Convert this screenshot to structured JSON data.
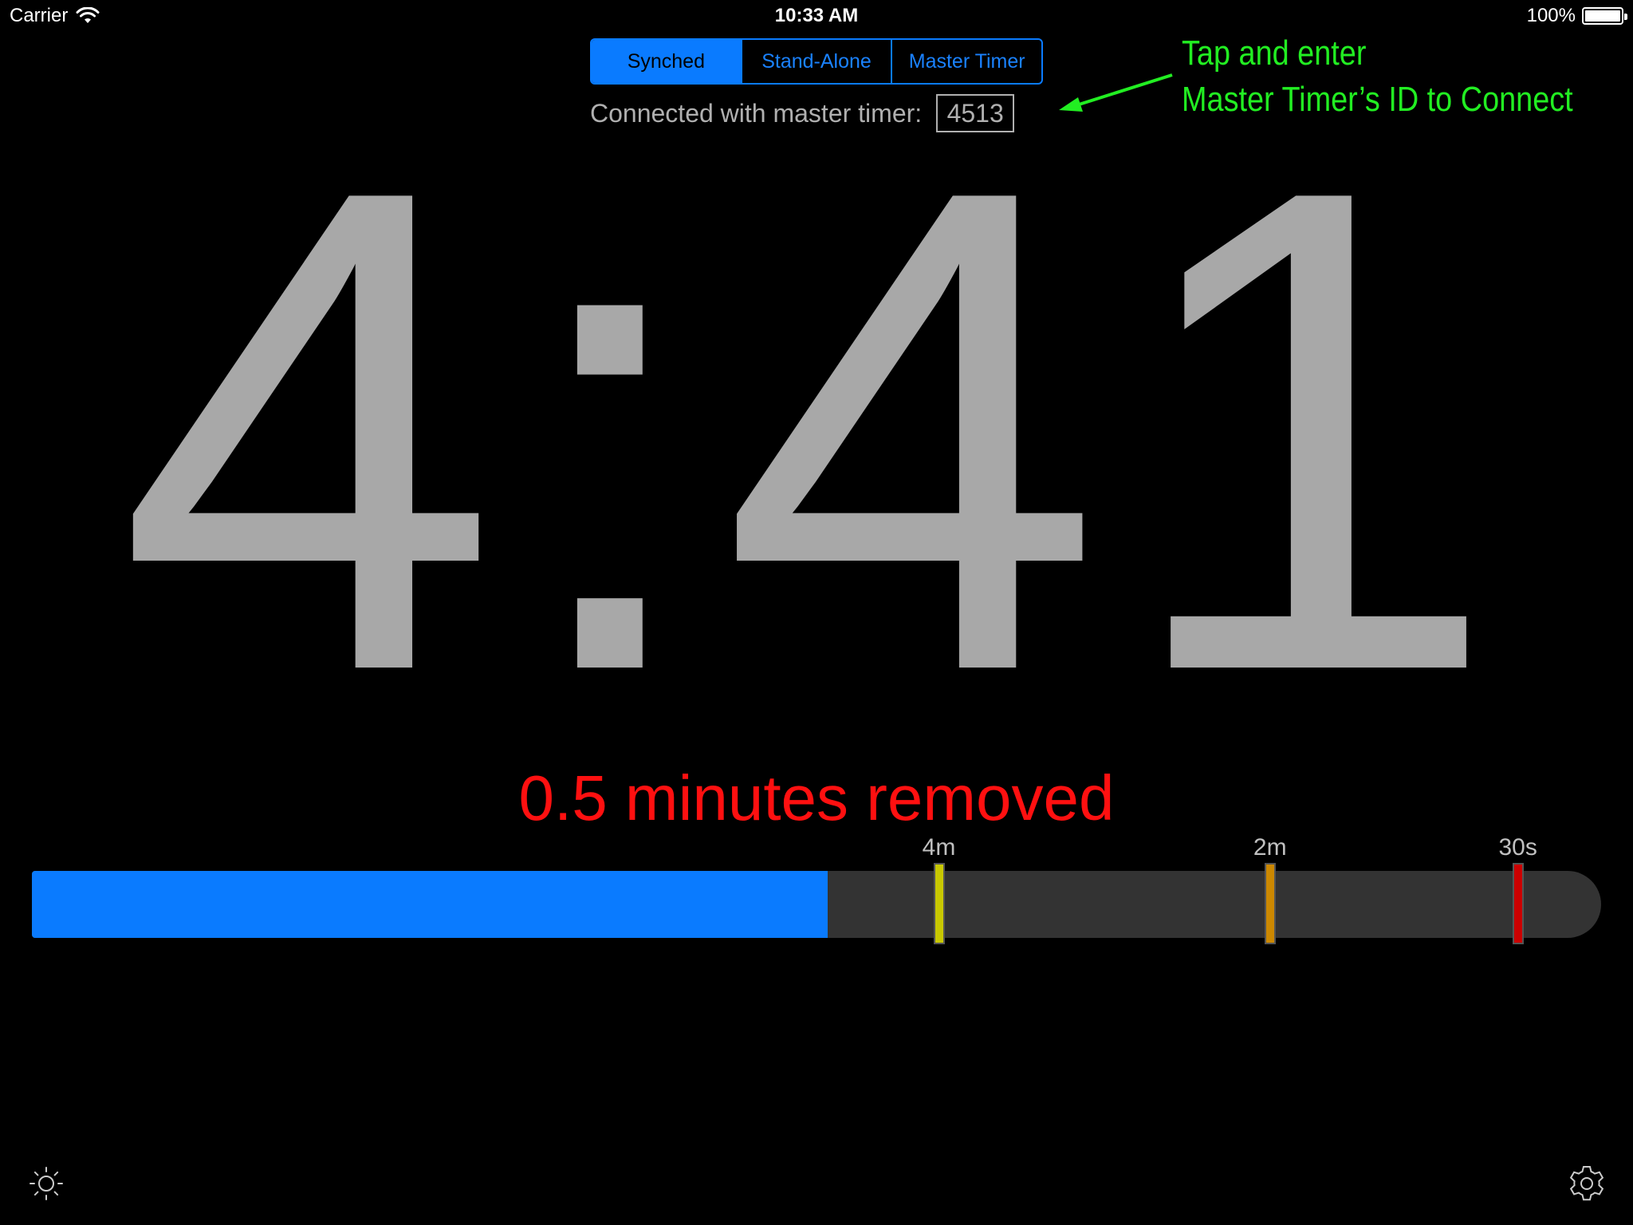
{
  "status_bar": {
    "carrier": "Carrier",
    "time": "10:33 AM",
    "battery": "100%"
  },
  "mode_selector": {
    "segments": [
      {
        "label": "Synched",
        "selected": true
      },
      {
        "label": "Stand-Alone",
        "selected": false
      },
      {
        "label": "Master Timer",
        "selected": false
      }
    ]
  },
  "connection": {
    "label": "Connected with master timer:",
    "master_id": "4513"
  },
  "annotation": {
    "line1": "Tap and enter",
    "line2": "Master Timer’s ID to Connect",
    "color": "#22ee22"
  },
  "timer": {
    "display": "4:41"
  },
  "message": {
    "text": "0.5 minutes removed",
    "color": "#ff1010"
  },
  "progress": {
    "fraction_elapsed": 0.507,
    "markers": [
      {
        "label": "4m",
        "color": "#c8c800",
        "fraction": 0.578
      },
      {
        "label": "2m",
        "color": "#cc8800",
        "fraction": 0.789
      },
      {
        "label": "30s",
        "color": "#cc0000",
        "fraction": 0.947
      }
    ]
  },
  "icons": {
    "brightness": "brightness-icon",
    "settings": "gear-icon",
    "wifi": "wifi-icon",
    "battery": "battery-icon"
  },
  "colors": {
    "accent": "#0a7bff",
    "time_text": "#a8a8a8",
    "track": "#333333"
  }
}
